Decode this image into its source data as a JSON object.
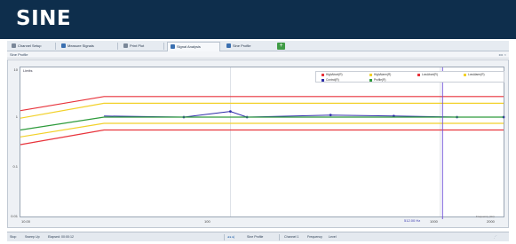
{
  "banner": {
    "title": "SINE"
  },
  "tabs": [
    {
      "label": "Channel Setup",
      "color": "#7a8798"
    },
    {
      "label": "Measure Signals",
      "color": "#3a6fb0"
    },
    {
      "label": "Print Plot",
      "color": "#7a8798"
    },
    {
      "label": "Signal Analysis",
      "color": "#3a6fb0",
      "active": true
    },
    {
      "label": "Sine Profile",
      "color": "#3a6fb0"
    }
  ],
  "subbar": {
    "label": "Sine Profile"
  },
  "chart": {
    "name": "Limits",
    "legend": [
      {
        "label": "HighAbort(R)",
        "color": "#e8343c"
      },
      {
        "label": "HighAlarm(R)",
        "color": "#f2d12a"
      },
      {
        "label": "LowAbort(R)",
        "color": "#e8343c"
      },
      {
        "label": "LowAlarm(R)",
        "color": "#f2d12a"
      },
      {
        "label": "Control(R)",
        "color": "#2c2ca8"
      },
      {
        "label": "Profile(R)",
        "color": "#2e9b3c"
      }
    ],
    "yticks": [
      "10",
      "1",
      "0.1",
      "0.01"
    ],
    "xticks": [
      "10.00",
      "100",
      "1000",
      "2000"
    ],
    "cursor_label": "512.00 Hz",
    "corner_note": "Frequency (Hz)"
  },
  "chart_data": {
    "type": "line",
    "title": "",
    "xlabel": "",
    "ylabel": "",
    "xscale": "log",
    "yscale": "log",
    "xlim": [
      10,
      2000
    ],
    "ylim": [
      0.01,
      10
    ],
    "grid": false,
    "legend_position": "top-right",
    "series": [
      {
        "name": "HighAbort(R)",
        "color": "#e8343c",
        "x": [
          10,
          25,
          2000
        ],
        "y": [
          1.35,
          2.6,
          2.6
        ]
      },
      {
        "name": "HighAlarm(R)",
        "color": "#f2d12a",
        "x": [
          10,
          25,
          2000
        ],
        "y": [
          0.95,
          1.9,
          1.9
        ]
      },
      {
        "name": "Control(R)",
        "color": "#2c2ca8",
        "x": [
          25,
          60,
          100,
          120,
          300,
          600,
          1200,
          2000
        ],
        "y": [
          1.05,
          1.0,
          1.3,
          1.0,
          1.1,
          1.05,
          1.0,
          1.0
        ]
      },
      {
        "name": "Profile(R)",
        "color": "#2e9b3c",
        "x": [
          10,
          25,
          2000
        ],
        "y": [
          0.55,
          1.0,
          1.0
        ]
      },
      {
        "name": "LowAlarm(R)",
        "color": "#f2d12a",
        "x": [
          10,
          25,
          2000
        ],
        "y": [
          0.4,
          0.75,
          0.75
        ]
      },
      {
        "name": "LowAbort(R)",
        "color": "#e8343c",
        "x": [
          10,
          25,
          2000
        ],
        "y": [
          0.28,
          0.55,
          0.55
        ]
      }
    ],
    "cursor_x": 1024
  },
  "statusbar": [
    "Stop",
    "Sweep Up",
    "Elapsed: 00:00:12",
    "Sine Profile",
    "Channel 1",
    "Frequency",
    "Level"
  ]
}
